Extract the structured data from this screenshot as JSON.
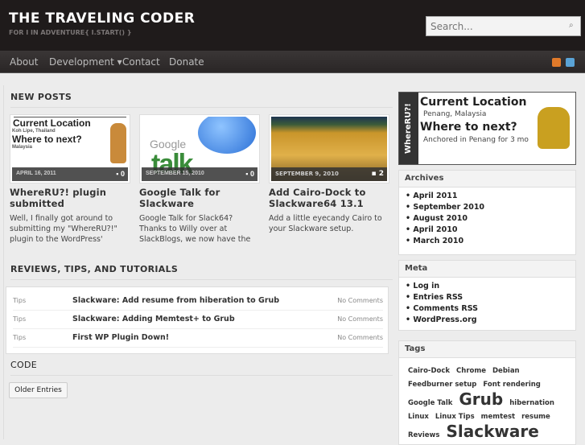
{
  "header": {
    "title": "THE TRAVELING CODER",
    "tagline": "FOR I IN ADVENTURE{ I.START() }",
    "search_placeholder": "Search..."
  },
  "nav": {
    "items": [
      "About",
      "Development ▾",
      "Contact",
      "Donate"
    ]
  },
  "new_posts": {
    "heading": "NEW POSTS",
    "posts": [
      {
        "date": "APRIL 16, 2011",
        "comments": "0",
        "title": "WhereRU?! plugin submitted",
        "excerpt": "Well, I finally got around to submitting my \"WhereRU?!\" plugin to the WordPress'",
        "thumb": {
          "line1": "Current Location",
          "line2": "Koh Lipe, Thailand",
          "line3": "Where to next?",
          "line4": "Malaysia"
        }
      },
      {
        "date": "SEPTEMBER 15, 2010",
        "comments": "0",
        "title": "Google Talk for Slackware",
        "excerpt": "Google Talk for Slack64? Thanks to Willy over at SlackBlogs, we now have the",
        "thumb": {
          "line1": "Google",
          "line2": "talk"
        }
      },
      {
        "date": "SEPTEMBER 9, 2010",
        "comments": "2",
        "title": "Add Cairo-Dock to Slackware64 13.1",
        "excerpt": "Add a little eyecandy Cairo to your Slackware setup."
      }
    ]
  },
  "reviews": {
    "heading": "REVIEWS, TIPS, AND TUTORIALS",
    "rows": [
      {
        "category": "Tips",
        "title": "Slackware: Add resume from hiberation to Grub",
        "comments": "No Comments"
      },
      {
        "category": "Tips",
        "title": "Slackware: Adding Memtest+ to Grub",
        "comments": "No Comments"
      },
      {
        "category": "Tips",
        "title": "First WP Plugin Down!",
        "comments": "No Comments"
      }
    ]
  },
  "code": {
    "heading": "CODE"
  },
  "older_entries": "Older Entries",
  "location": {
    "brand": "WhereRU?!",
    "current_label": "Current Location",
    "current": "Penang, Malaysia",
    "next_label": "Where to next?",
    "next": "Anchored in Penang for 3 mo"
  },
  "archives": {
    "heading": "Archives",
    "items": [
      "April 2011",
      "September 2010",
      "August 2010",
      "April 2010",
      "March 2010"
    ]
  },
  "meta": {
    "heading": "Meta",
    "items": [
      "Log in",
      "Entries RSS",
      "Comments RSS",
      "WordPress.org"
    ]
  },
  "tags": {
    "heading": "Tags",
    "items": [
      {
        "label": "Cairo-Dock",
        "size": 8.5
      },
      {
        "label": "Chrome",
        "size": 8.5
      },
      {
        "label": "Debian",
        "size": 8.5
      },
      {
        "label": "Feedburner setup",
        "size": 8.5
      },
      {
        "label": "Font rendering",
        "size": 8.5
      },
      {
        "label": "Google Talk",
        "size": 8.5
      },
      {
        "label": "Grub",
        "size": 20
      },
      {
        "label": "hibernation",
        "size": 8.5
      },
      {
        "label": "Linux",
        "size": 8.5
      },
      {
        "label": "Linux Tips",
        "size": 8.5
      },
      {
        "label": "memtest",
        "size": 8.5
      },
      {
        "label": "resume",
        "size": 8.5
      },
      {
        "label": "Reviews",
        "size": 8.5
      },
      {
        "label": "Slackware",
        "size": 20
      }
    ]
  },
  "colors": {
    "header_bg": "#1f1b1b",
    "body_bg": "#ececec",
    "rss": "#e07a2a",
    "twitter": "#5aa3d6"
  }
}
